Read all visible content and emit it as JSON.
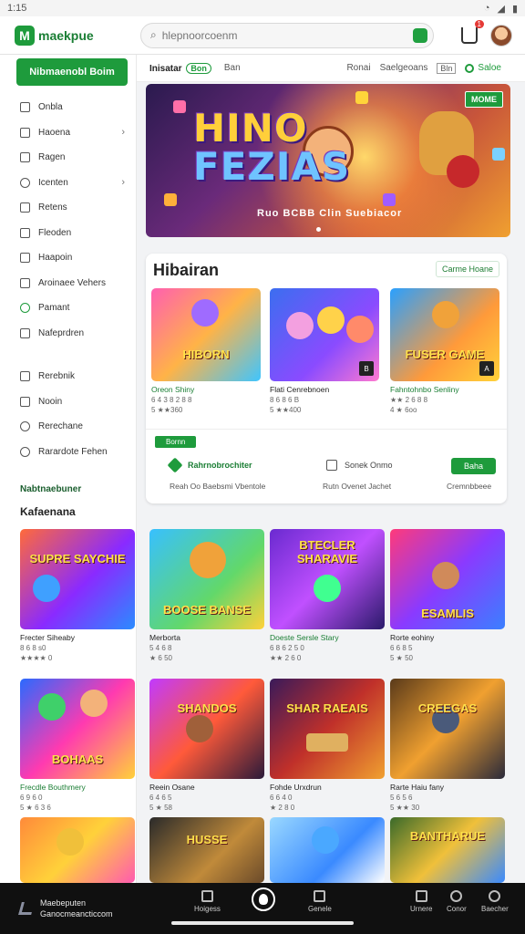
{
  "status_bar": {
    "time": "1:15"
  },
  "topbar": {
    "brand": "maekpue",
    "search_placeholder": "hlepnoorcoenm",
    "cart_count": "1"
  },
  "sidebar": {
    "cta": "Nibmaenobl Boim",
    "items": [
      {
        "label": "Onbla",
        "icon": "document-icon"
      },
      {
        "label": "Haoena",
        "icon": "star-icon",
        "chevron": true
      },
      {
        "label": "Ragen",
        "icon": "image-icon"
      },
      {
        "label": "Icenten",
        "icon": "link-icon",
        "chevron": true
      },
      {
        "label": "Retens",
        "icon": "camera-icon"
      },
      {
        "label": "Fleoden",
        "icon": "music-icon"
      },
      {
        "label": "Haapoin",
        "icon": "bookmark-icon"
      },
      {
        "label": "Aroinaee Vehers",
        "icon": "controller-icon"
      },
      {
        "label": "Pamant",
        "icon": "green-circle-icon"
      },
      {
        "label": "Nafeprdren",
        "icon": "chat-icon"
      }
    ],
    "items2": [
      {
        "label": "Rerebnik",
        "icon": "grid-icon"
      },
      {
        "label": "Nooin",
        "icon": "tag-icon"
      },
      {
        "label": "Rerechane",
        "icon": "clock-icon"
      },
      {
        "label": "Rarardote Fehen",
        "icon": "user-icon"
      }
    ],
    "heading1": "Nabtnaebuner",
    "heading2": "Kafaenana"
  },
  "tabs": {
    "items": [
      "Inisatar",
      "Ban"
    ],
    "active_pill": "Bon",
    "right_items": [
      "Ronai",
      "Saelgeoans"
    ],
    "box_label": "Bln",
    "save_label": "Saloe"
  },
  "hero": {
    "title_line1": "HINO",
    "title_line2": "FEZIAS",
    "subtitle": "Ruo BCBB Clin Suebiacor",
    "badge": "MOME"
  },
  "featured": {
    "heading": "Hibairan",
    "more_label": "Carme Hoane",
    "games": [
      {
        "title": "HIBORN",
        "name": "Oreon Shiny",
        "meta": "6 4 3 8 2 8 8",
        "rating": "5 ★★360"
      },
      {
        "title": "",
        "name": "Flati Cenrebnoen",
        "meta": "8 6 8 6 B",
        "rating": "5 ★★400"
      },
      {
        "title": "FUSER GAME",
        "name": "Fahntohnbo Senliny",
        "meta": "★★ 2 6 8 8",
        "rating": "4 ★ 6oo"
      }
    ],
    "promo_button": "Bornn",
    "promo_left": "Rahrnobrochiter",
    "promo_left_sub": "Reah Oo Baebsmi Vbentole",
    "promo_mid": "Sonek Onmo",
    "promo_mid_sub": "Rutn Ovenet Jachet",
    "promo_action": "Baha",
    "promo_right_sub": "Cremnbbeee"
  },
  "grid": [
    {
      "title": "SUPRE SAYCHIE",
      "name": "Frecter Siheaby",
      "meta": "8 6 8 s0",
      "rating": "★★★★ 0"
    },
    {
      "title": "BOOSE BANSE",
      "name": "Merborta",
      "meta": "5 4 6 8",
      "rating": "★ 6 50"
    },
    {
      "title": "BTECLER SHARAVIE",
      "name": "Doeste Sersle Stary",
      "meta": "6 8 6 2 5 0",
      "rating": "★★ 2 6 0"
    },
    {
      "title": "ESAMLIS",
      "name": "Rorte eohiny",
      "meta": "6 6 8 5",
      "rating": "5 ★ 50"
    },
    {
      "title": "BOHAAS",
      "name": "Frecdle Bouthmery",
      "meta": "6 9 6 0",
      "rating": "5 ★ 6 3 6"
    },
    {
      "title": "SHANDOS",
      "name": "Reein Osane",
      "meta": "6 4 6 5",
      "rating": "5 ★ 58"
    },
    {
      "title": "SHAR RAEAIS",
      "name": "Fohde Urxdrun",
      "meta": "6 6 4 0",
      "rating": "★ 2 8 0"
    },
    {
      "title": "CREEGAS",
      "name": "Rarte Haiu fany",
      "meta": "5 6 5 6",
      "rating": "5 ★★ 30"
    },
    {
      "title": "",
      "name": "",
      "meta": "",
      "rating": ""
    },
    {
      "title": "HUSSE",
      "name": "",
      "meta": "",
      "rating": ""
    },
    {
      "title": "",
      "name": "",
      "meta": "",
      "rating": ""
    },
    {
      "title": "BANTHARUE",
      "name": "",
      "meta": "",
      "rating": ""
    }
  ],
  "bottom_nav": {
    "brand_line1": "Maebeputen",
    "brand_line2": "Ganocmeancticcom",
    "items": [
      "Hoigess",
      "Genele",
      "Urnere",
      "Conor",
      "Baecher"
    ]
  }
}
